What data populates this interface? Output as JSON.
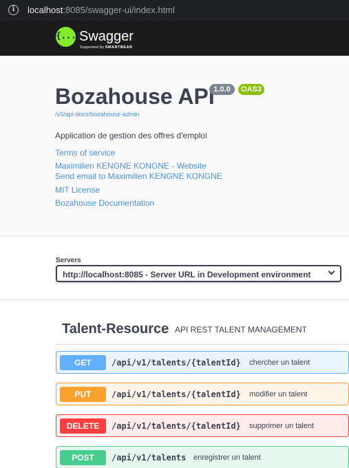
{
  "browser": {
    "url_host": "localhost",
    "url_rest": ":8085/swagger-ui/index.html",
    "info_icon": "info-icon"
  },
  "topbar": {
    "logo_glyph": "{...}",
    "brand": "Swagger",
    "supported_by": "Supported by",
    "smartbear": "SMARTBEAR"
  },
  "info": {
    "title": "Bozahouse API",
    "version": "1.0.0",
    "oas": "OAS3",
    "doc_url": "/v3/api-docs/bozahouse-admin",
    "description": "Application de gestion des offres d'emploi",
    "links": [
      "Terms of service",
      "Maximilien KENGNE KONGNE - Website",
      "Send email to Maximilien KENGNE KONGNE",
      "MIT License",
      "Bozahouse Documentation"
    ]
  },
  "servers": {
    "label": "Servers",
    "selected": "http://localhost:8085 - Server URL in Development environment"
  },
  "tag": {
    "name": "Talent-Resource",
    "description": "API REST TALENT MANAGEMENT"
  },
  "operations": [
    {
      "method": "GET",
      "path": "/api/v1/talents/{talentId}",
      "summary": "chercher un talent"
    },
    {
      "method": "PUT",
      "path": "/api/v1/talents/{talentId}",
      "summary": "modifier un talent"
    },
    {
      "method": "DELETE",
      "path": "/api/v1/talents/{talentId}",
      "summary": "supprimer un talent"
    },
    {
      "method": "POST",
      "path": "/api/v1/talents",
      "summary": "enregistrer un talent"
    }
  ],
  "colors": {
    "get": "#61affe",
    "put": "#fca130",
    "delete": "#f93e3e",
    "post": "#49cc90",
    "accent": "#85ea2d"
  }
}
